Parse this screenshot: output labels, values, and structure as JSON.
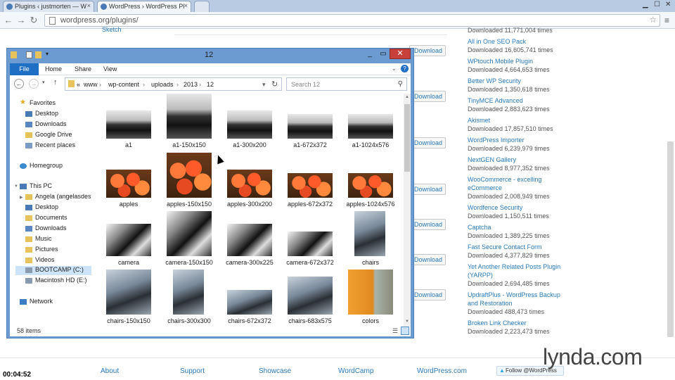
{
  "browser": {
    "tabs": [
      {
        "label": "Plugins ‹ justmorten — W"
      },
      {
        "label": "WordPress › WordPress Pl"
      }
    ],
    "url": "wordpress.org/plugins/"
  },
  "wp": {
    "partial_text": "Sketch",
    "button_label": "Download",
    "plugins": [
      {
        "name": "",
        "downloads": "Downloaded 11,771,004 times"
      },
      {
        "name": "All in One SEO Pack",
        "downloads": "Downloaded 16,605,741 times"
      },
      {
        "name": "WPtouch Mobile Plugin",
        "downloads": "Downloaded 4,664,653 times"
      },
      {
        "name": "Better WP Security",
        "downloads": "Downloaded 1,350,618 times"
      },
      {
        "name": "TinyMCE Advanced",
        "downloads": "Downloaded 2,883,623 times"
      },
      {
        "name": "Akismet",
        "downloads": "Downloaded 17,857,510 times"
      },
      {
        "name": "WordPress Importer",
        "downloads": "Downloaded 6,239,979 times"
      },
      {
        "name": "NextGEN Gallery",
        "downloads": "Downloaded 8,977,352 times"
      },
      {
        "name": "WooCommerce - excelling eCommerce",
        "downloads": "Downloaded 2,008,949 times"
      },
      {
        "name": "Wordfence Security",
        "downloads": "Downloaded 1,150,511 times"
      },
      {
        "name": "Captcha",
        "downloads": "Downloaded 1,389,225 times"
      },
      {
        "name": "Fast Secure Contact Form",
        "downloads": "Downloaded 4,377,829 times"
      },
      {
        "name": "Yet Another Related Posts Plugin (YARPP)",
        "downloads": "Downloaded 2,694,485 times"
      },
      {
        "name": "UpdraftPlus - WordPress Backup and Restoration",
        "downloads": "Downloaded 488,473 times"
      },
      {
        "name": "Broken Link Checker",
        "downloads": "Downloaded 2,223,473 times"
      }
    ],
    "footer": {
      "about": "About",
      "support": "Support",
      "showcase": "Showcase",
      "wordcamp": "WordCamp",
      "wordpress_tv": "WordPress.com",
      "follow": "Follow @WordPress"
    }
  },
  "explorer": {
    "title": "12",
    "ribbon": {
      "file": "File",
      "home": "Home",
      "share": "Share",
      "view": "View"
    },
    "path": [
      "www",
      "wp-content",
      "uploads",
      "2013",
      "12"
    ],
    "search_placeholder": "Search 12",
    "nav": {
      "favorites": "Favorites",
      "desktop": "Desktop",
      "downloads": "Downloads",
      "google_drive": "Google Drive",
      "recent_places": "Recent places",
      "homegroup": "Homegroup",
      "this_pc": "This PC",
      "user": "Angela (angelasdesk",
      "pc_desktop": "Desktop",
      "documents": "Documents",
      "pc_downloads": "Downloads",
      "music": "Music",
      "pictures": "Pictures",
      "videos": "Videos",
      "bootcamp": "BOOTCAMP (C:)",
      "macintosh": "Macintosh HD (E:)",
      "network": "Network"
    },
    "files": [
      "a1",
      "a1-150x150",
      "a1-300x200",
      "a1-672x372",
      "a1-1024x576",
      "apples",
      "apples-150x150",
      "apples-300x200",
      "apples-672x372",
      "apples-1024x576",
      "camera",
      "camera-150x150",
      "camera-300x225",
      "camera-672x372",
      "chairs",
      "chairs-150x150",
      "chairs-300x300",
      "chairs-672x372",
      "chairs-683x575",
      "colors"
    ],
    "item_count": "58 items"
  },
  "lynda": "lynda.com",
  "timecode": "00:04:52"
}
